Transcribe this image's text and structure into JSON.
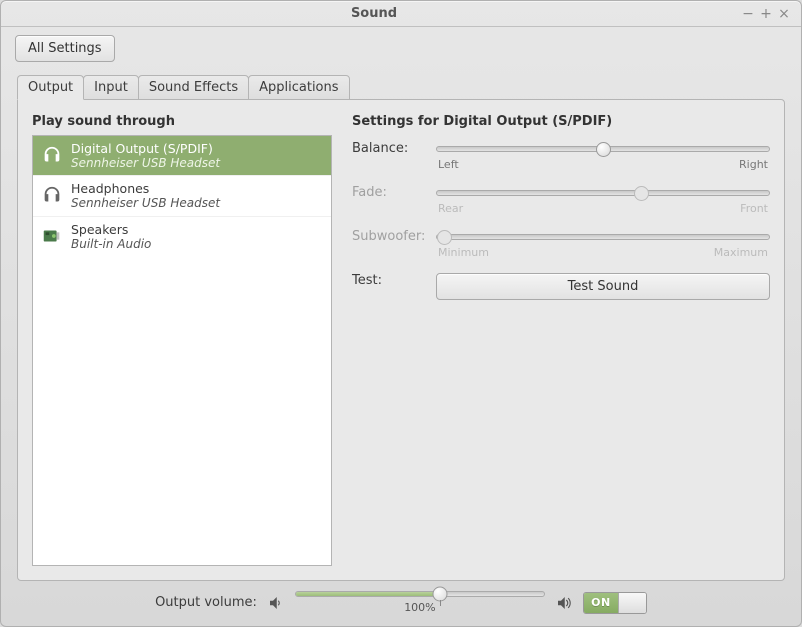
{
  "window": {
    "title": "Sound"
  },
  "toolbar": {
    "all_settings": "All Settings"
  },
  "tabs": [
    {
      "label": "Output",
      "active": true
    },
    {
      "label": "Input",
      "active": false
    },
    {
      "label": "Sound Effects",
      "active": false
    },
    {
      "label": "Applications",
      "active": false
    }
  ],
  "left": {
    "header": "Play sound through",
    "devices": [
      {
        "name": "Digital Output (S/PDIF)",
        "sub": "Sennheiser USB Headset",
        "icon": "headset",
        "selected": true
      },
      {
        "name": "Headphones",
        "sub": "Sennheiser USB Headset",
        "icon": "headset",
        "selected": false
      },
      {
        "name": "Speakers",
        "sub": "Built-in Audio",
        "icon": "card",
        "selected": false
      }
    ]
  },
  "right": {
    "header": "Settings for Digital Output (S/PDIF)",
    "balance": {
      "label": "Balance:",
      "left": "Left",
      "right": "Right",
      "value": 50,
      "enabled": true
    },
    "fade": {
      "label": "Fade:",
      "left": "Rear",
      "right": "Front",
      "value": 62,
      "enabled": false
    },
    "subwoofer": {
      "label": "Subwoofer:",
      "left": "Minimum",
      "right": "Maximum",
      "value": 0,
      "enabled": false
    },
    "test": {
      "label": "Test:",
      "button": "Test Sound"
    }
  },
  "bottom": {
    "label": "Output volume:",
    "percent_text": "100%",
    "percent": 58,
    "switch_on": "ON"
  }
}
